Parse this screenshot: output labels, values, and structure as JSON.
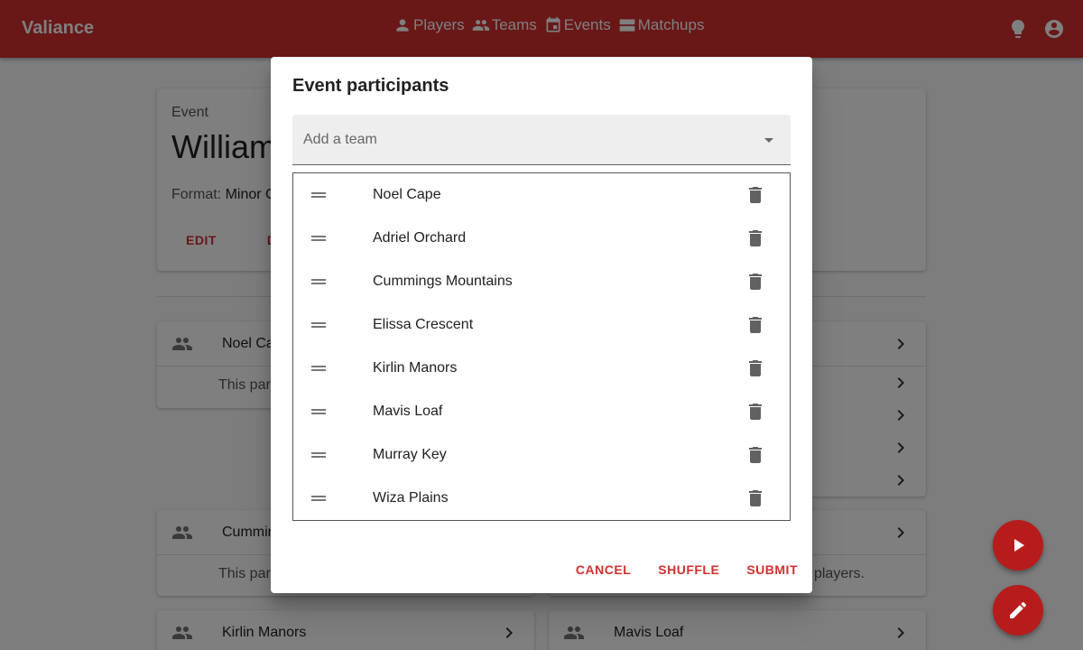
{
  "app": {
    "title": "Valiance",
    "nav": [
      {
        "label": "Players",
        "icon": "person-icon"
      },
      {
        "label": "Teams",
        "icon": "group-icon"
      },
      {
        "label": "Events",
        "icon": "event-icon"
      },
      {
        "label": "Matchups",
        "icon": "matchups-icon"
      }
    ],
    "right_icons": [
      "lightbulb-icon",
      "account-circle-icon"
    ]
  },
  "event": {
    "label": "Event",
    "name": "William",
    "format_label": "Format:",
    "format_value": "Minor C",
    "edit_label": "EDIT",
    "delete_label": "DELETE"
  },
  "background_teams": [
    {
      "name": "Noel Ca",
      "body": "This par"
    },
    {
      "name": "Cummin",
      "body": "This par"
    },
    {
      "name": "Kirlin Manors"
    },
    {
      "name": "Mavis Loaf"
    }
  ],
  "background_right_text": "players.",
  "dialog": {
    "title": "Event participants",
    "select_placeholder": "Add a team",
    "participants": [
      "Noel Cape",
      "Adriel Orchard",
      "Cummings Mountains",
      "Elissa Crescent",
      "Kirlin Manors",
      "Mavis Loaf",
      "Murray Key",
      "Wiza Plains"
    ],
    "cancel_label": "CANCEL",
    "shuffle_label": "SHUFFLE",
    "submit_label": "SUBMIT"
  },
  "colors": {
    "primary": "#d32f2f",
    "fab": "#b71c1c"
  }
}
